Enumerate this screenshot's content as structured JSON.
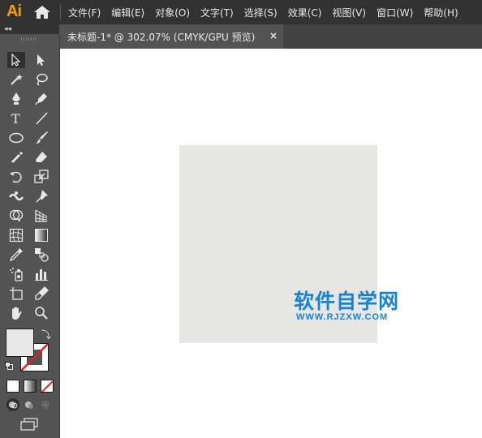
{
  "app": {
    "logo": "Ai"
  },
  "menu": {
    "items": [
      "文件(F)",
      "编辑(E)",
      "对象(O)",
      "文字(T)",
      "选择(S)",
      "效果(C)",
      "视图(V)",
      "窗口(W)",
      "帮助(H)"
    ]
  },
  "toolbar": {
    "collapse": "◂◂",
    "tools": [
      {
        "name": "selection-tool-icon",
        "active": true
      },
      {
        "name": "direct-selection-tool-icon"
      },
      {
        "name": "magic-wand-tool-icon"
      },
      {
        "name": "lasso-tool-icon"
      },
      {
        "name": "pen-tool-icon"
      },
      {
        "name": "curvature-tool-icon"
      },
      {
        "name": "type-tool-icon",
        "glyph": "T"
      },
      {
        "name": "line-segment-tool-icon"
      },
      {
        "name": "ellipse-tool-icon"
      },
      {
        "name": "paintbrush-tool-icon"
      },
      {
        "name": "shaper-tool-icon"
      },
      {
        "name": "eraser-tool-icon"
      },
      {
        "name": "rotate-tool-icon"
      },
      {
        "name": "scale-tool-icon"
      },
      {
        "name": "width-tool-icon"
      },
      {
        "name": "puppet-warp-tool-icon"
      },
      {
        "name": "shape-builder-tool-icon"
      },
      {
        "name": "perspective-grid-tool-icon"
      },
      {
        "name": "mesh-tool-icon"
      },
      {
        "name": "gradient-tool-icon"
      },
      {
        "name": "eyedropper-tool-icon"
      },
      {
        "name": "blend-tool-icon"
      },
      {
        "name": "symbol-sprayer-tool-icon"
      },
      {
        "name": "column-graph-tool-icon"
      },
      {
        "name": "artboard-tool-icon"
      },
      {
        "name": "slice-tool-icon"
      },
      {
        "name": "hand-tool-icon"
      },
      {
        "name": "zoom-tool-icon"
      }
    ],
    "fill_color": "#e8e8e8",
    "stroke": "none"
  },
  "document": {
    "tab_title": "未标题-1* @ 302.07% (CMYK/GPU 预览)",
    "close": "×"
  },
  "canvas": {
    "square_color": "#e6e6e4"
  },
  "watermark": {
    "text": "软件自学网",
    "url": "WWW.RJZXW.COM",
    "color": "#1783d3"
  }
}
